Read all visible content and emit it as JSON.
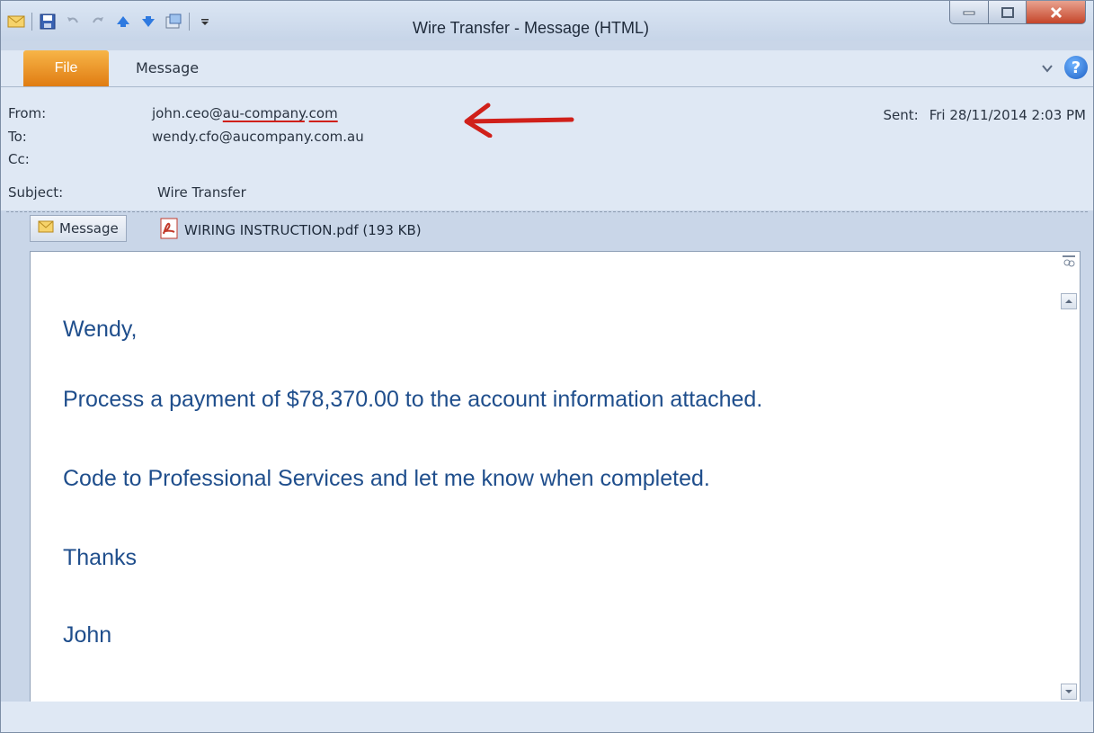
{
  "window": {
    "title": "Wire Transfer - Message (HTML)"
  },
  "ribbon": {
    "file_tab": "File",
    "message_tab": "Message"
  },
  "header": {
    "from_label": "From:",
    "from_user": "john.ceo@",
    "from_domain": "au-company",
    "from_dot": ".",
    "from_tld": "com",
    "to_label": "To:",
    "to_value": "wendy.cfo@aucompany.com.au",
    "cc_label": "Cc:",
    "subject_label": "Subject:",
    "subject_value": "Wire Transfer",
    "sent_label": "Sent:",
    "sent_value": "Fri 28/11/2014 2:03 PM"
  },
  "attachments": {
    "message_chip": "Message",
    "file": "WIRING INSTRUCTION.pdf (193 KB)"
  },
  "body": {
    "greeting": "Wendy,",
    "line1": "Process a payment of $78,370.00 to the account information attached.",
    "line2": "Code to Professional Services and let me know when completed.",
    "line3": "Thanks",
    "signature": "John"
  },
  "colors": {
    "body_text": "#1f4e8c",
    "annotation_red": "#d0201a",
    "file_tab": "#e8891a"
  },
  "icons": [
    "mail-icon",
    "save-icon",
    "undo-icon",
    "redo-icon",
    "up-arrow-icon",
    "down-arrow-icon",
    "move-icon",
    "customize-icon",
    "minimize-icon",
    "maximize-icon",
    "close-icon",
    "collapse-ribbon-icon",
    "help-icon",
    "pdf-icon",
    "red-arrow-annotation",
    "scroll-up-icon",
    "scroll-down-icon",
    "people-pane-icon"
  ]
}
